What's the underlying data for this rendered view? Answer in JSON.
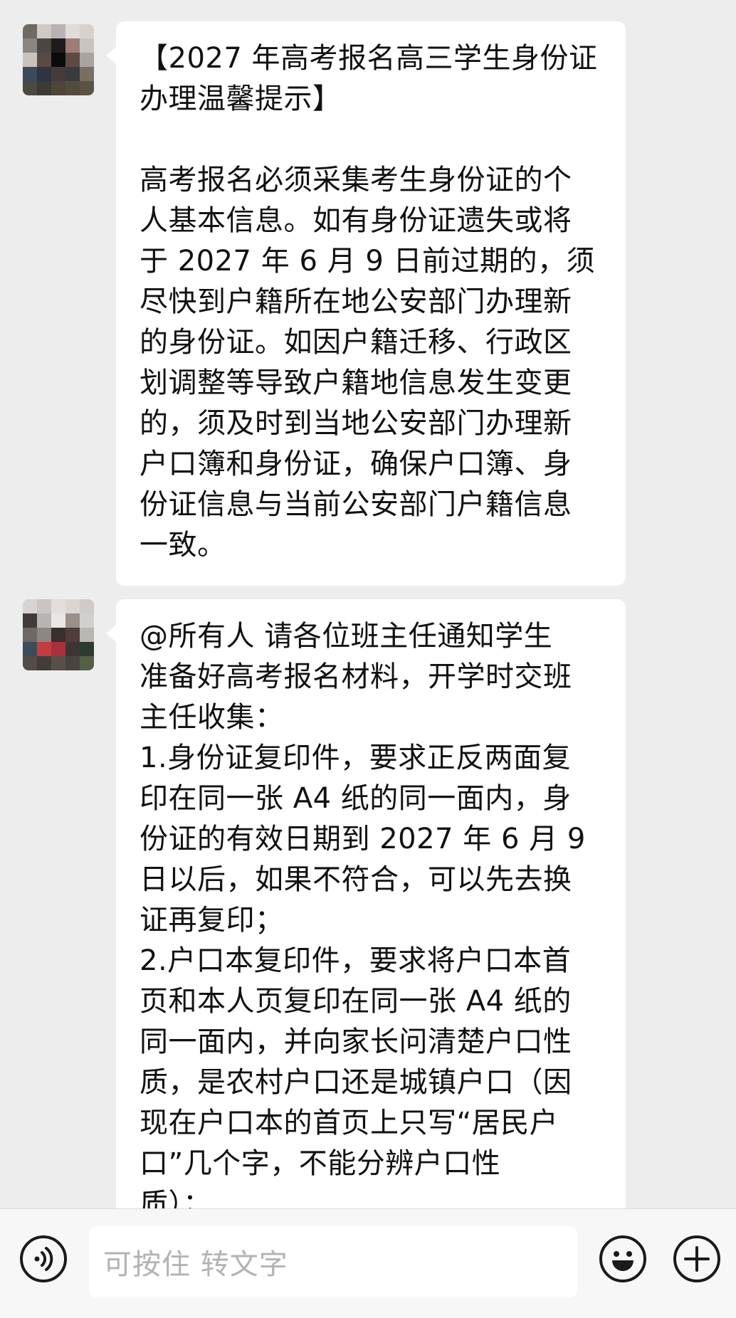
{
  "messages": [
    {
      "lines": [
        "【2027 年高考报名高三学生身份证",
        "办理温馨提示】",
        "",
        "高考报名必须采集考生身份证的个",
        "人基本信息。如有身份证遗失或将",
        "于 2027 年 6 月 9 日前过期的，须",
        "尽快到户籍所在地公安部门办理新",
        "的身份证。如因户籍迁移、行政区",
        "划调整等导致户籍地信息发生变更",
        "的，须及时到当地公安部门办理新",
        "户口簿和身份证，确保户口簿、身",
        "份证信息与当前公安部门户籍信息",
        "一致。"
      ]
    },
    {
      "lines": [
        "@所有人  请各位班主任通知学生",
        "准备好高考报名材料，开学时交班",
        "主任收集：",
        "1.身份证复印件，要求正反两面复",
        "印在同一张 A4 纸的同一面内，身",
        "份证的有效日期到 2027 年 6 月 9",
        "日以后，如果不符合，可以先去换",
        "证再复印；",
        "2.户口本复印件，要求将户口本首",
        "页和本人页复印在同一张 A4 纸的",
        "同一面内，并向家长问清楚户口性",
        "质，是农村户口还是城镇户口（因",
        "现在户口本的首页上只写“居民户",
        "口”几个字，不能分辨户口性",
        "质）；"
      ]
    }
  ],
  "input_bar": {
    "placeholder": "可按住 转文字",
    "voice_icon": "voice-icon",
    "emoji_icon": "emoji-icon",
    "plus_icon": "plus-icon"
  },
  "colors": {
    "background": "#ededed",
    "bubble": "#ffffff",
    "text": "#111111",
    "placeholder": "#b3b3b3"
  }
}
